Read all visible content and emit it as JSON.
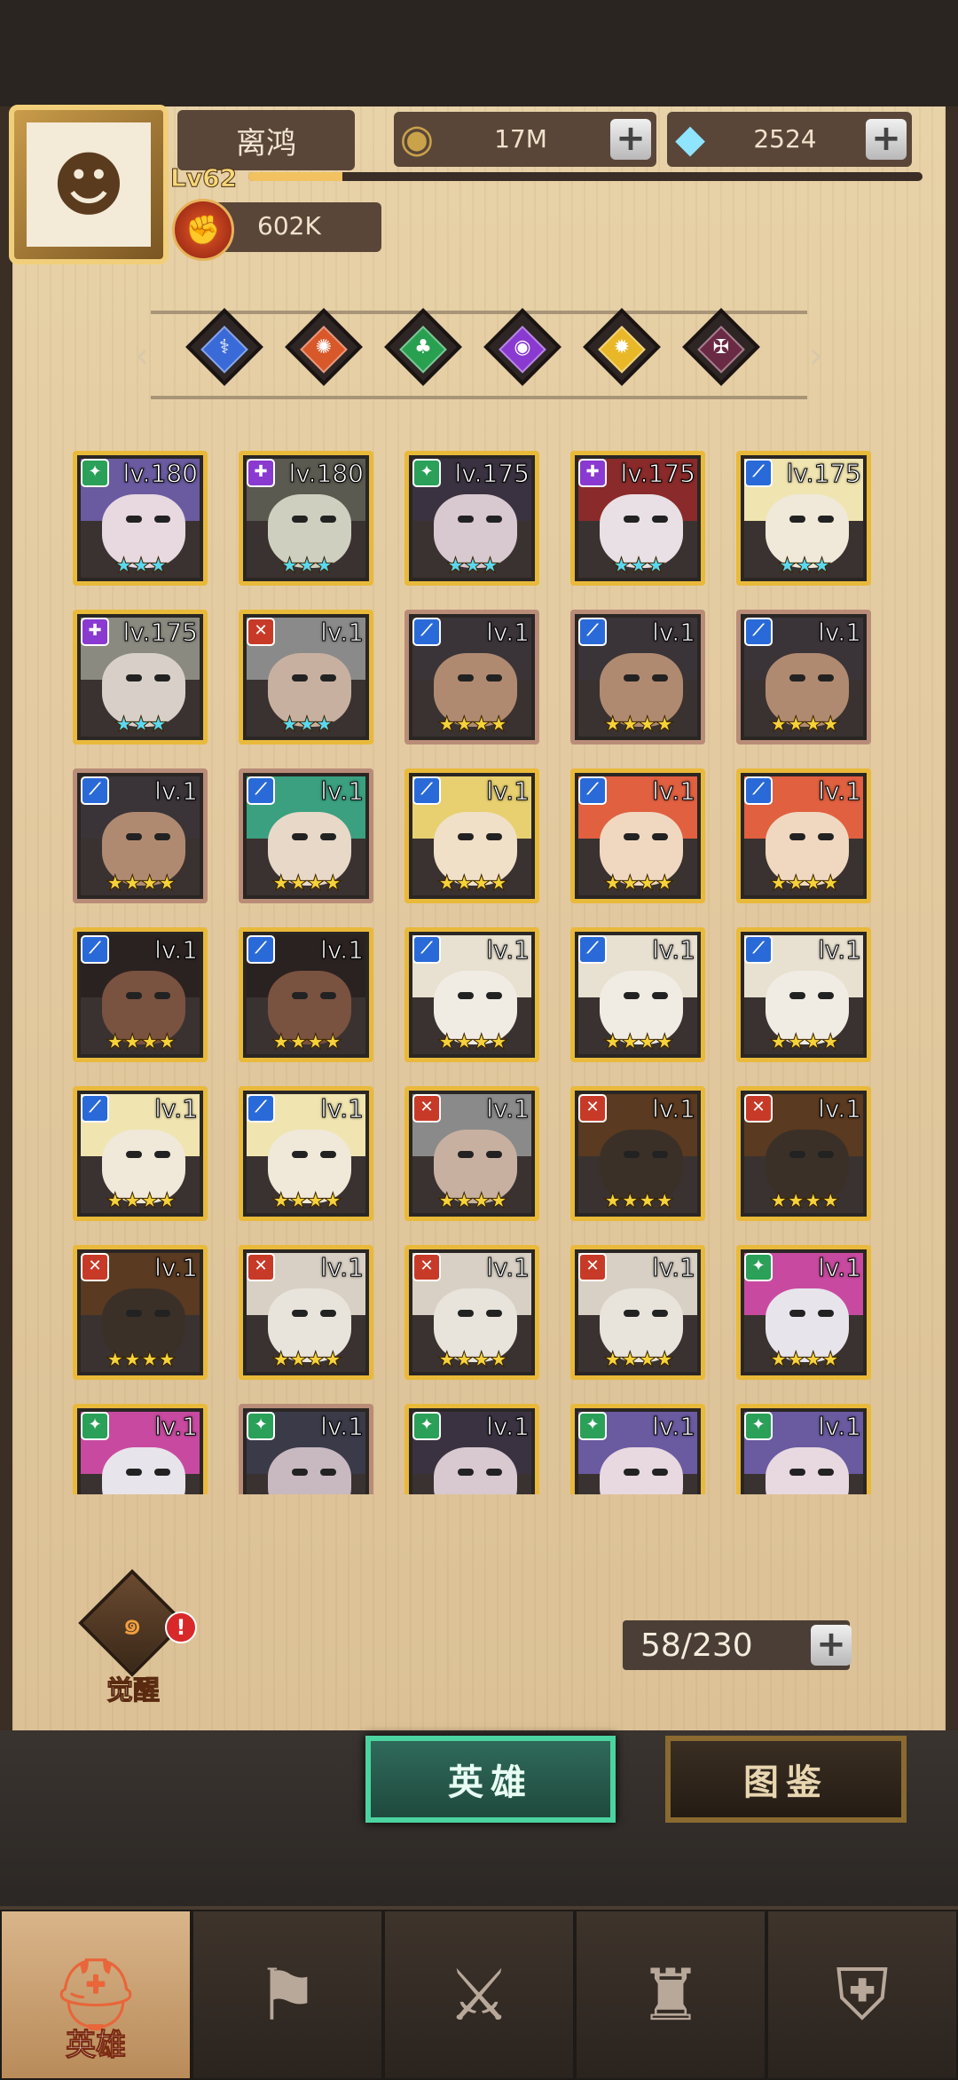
{
  "player": {
    "name": "离鸿",
    "level": "Lv62",
    "power": "602K",
    "xp_fraction": 0.14
  },
  "currencies": [
    {
      "name": "gold",
      "value": "17M",
      "icon": "gold-coin-icon"
    },
    {
      "name": "diamond",
      "value": "2524",
      "icon": "diamond-icon"
    }
  ],
  "filters": [
    {
      "name": "filter-water",
      "color": "#3a6ad8",
      "glyph": "⚕"
    },
    {
      "name": "filter-fire",
      "color": "#d8582a",
      "glyph": "✺"
    },
    {
      "name": "filter-nature",
      "color": "#28a050",
      "glyph": "♣"
    },
    {
      "name": "filter-shadow",
      "color": "#8a3ad0",
      "glyph": "◉"
    },
    {
      "name": "filter-light",
      "color": "#e8b828",
      "glyph": "✹"
    },
    {
      "name": "filter-dark",
      "color": "#6a2a44",
      "glyph": "✠"
    }
  ],
  "heroes": [
    {
      "lv": "lv.180",
      "stars": "★★★",
      "star_color": "#5ad8f0",
      "cls": "green",
      "frame": "gold",
      "hair": "#6a5aa0",
      "skin": "#e8d8e0"
    },
    {
      "lv": "lv.180",
      "stars": "★★★",
      "star_color": "#5ad8f0",
      "cls": "purple",
      "frame": "gold",
      "hair": "#5a5a50",
      "skin": "#cfcfc0"
    },
    {
      "lv": "lv.175",
      "stars": "★★★",
      "star_color": "#5ad8f0",
      "cls": "green",
      "frame": "gold",
      "hair": "#3a3240",
      "skin": "#d8c8d0"
    },
    {
      "lv": "lv.175",
      "stars": "★★★",
      "star_color": "#5ad8f0",
      "cls": "purple",
      "frame": "gold",
      "hair": "#8a2a2a",
      "skin": "#e8e0e4"
    },
    {
      "lv": "lv.175",
      "stars": "★★★",
      "star_color": "#5ad8f0",
      "cls": "blue",
      "frame": "gold",
      "hair": "#f0e4b0",
      "skin": "#f0e8d8"
    },
    {
      "lv": "lv.175",
      "stars": "★★★",
      "star_color": "#5ad8f0",
      "cls": "purple",
      "frame": "gold",
      "hair": "#8a8a80",
      "skin": "#d8d0c8"
    },
    {
      "lv": "lv.1",
      "stars": "★★★",
      "star_color": "#5ad8f0",
      "cls": "red",
      "frame": "gold",
      "hair": "#8a8a8a",
      "skin": "#c8b0a0"
    },
    {
      "lv": "lv.1",
      "stars": "★★★★",
      "star_color": "#f6d23a",
      "cls": "blue",
      "frame": "red",
      "hair": "#3a3438",
      "skin": "#b08a70"
    },
    {
      "lv": "lv.1",
      "stars": "★★★★",
      "star_color": "#f6d23a",
      "cls": "blue",
      "frame": "red",
      "hair": "#3a3438",
      "skin": "#b08a70"
    },
    {
      "lv": "lv.1",
      "stars": "★★★★",
      "star_color": "#f6d23a",
      "cls": "blue",
      "frame": "red",
      "hair": "#3a3438",
      "skin": "#b08a70"
    },
    {
      "lv": "lv.1",
      "stars": "★★★★",
      "star_color": "#f6d23a",
      "cls": "blue",
      "frame": "red",
      "hair": "#3a3438",
      "skin": "#b08a70"
    },
    {
      "lv": "lv.1",
      "stars": "★★★★",
      "star_color": "#f6d23a",
      "cls": "blue",
      "frame": "red",
      "hair": "#3aa080",
      "skin": "#e8d8c8"
    },
    {
      "lv": "lv.1",
      "stars": "★★★★",
      "star_color": "#f6d23a",
      "cls": "blue",
      "frame": "gold",
      "hair": "#e8d070",
      "skin": "#f0e0c8"
    },
    {
      "lv": "lv.1",
      "stars": "★★★★",
      "star_color": "#f6d23a",
      "cls": "blue",
      "frame": "gold",
      "hair": "#e06040",
      "skin": "#f0d8c0"
    },
    {
      "lv": "lv.1",
      "stars": "★★★★",
      "star_color": "#f6d23a",
      "cls": "blue",
      "frame": "gold",
      "hair": "#e06040",
      "skin": "#f0d8c0"
    },
    {
      "lv": "lv.1",
      "stars": "★★★★",
      "star_color": "#f6d23a",
      "cls": "blue",
      "frame": "gold",
      "hair": "#2a2220",
      "skin": "#7a5240"
    },
    {
      "lv": "lv.1",
      "stars": "★★★★",
      "star_color": "#f6d23a",
      "cls": "blue",
      "frame": "gold",
      "hair": "#2a2220",
      "skin": "#7a5240"
    },
    {
      "lv": "lv.1",
      "stars": "★★★★",
      "star_color": "#f6d23a",
      "cls": "blue",
      "frame": "gold",
      "hair": "#e8e0d0",
      "skin": "#f0ece4"
    },
    {
      "lv": "lv.1",
      "stars": "★★★★",
      "star_color": "#f6d23a",
      "cls": "blue",
      "frame": "gold",
      "hair": "#e8e0d0",
      "skin": "#f0ece4"
    },
    {
      "lv": "lv.1",
      "stars": "★★★★",
      "star_color": "#f6d23a",
      "cls": "blue",
      "frame": "gold",
      "hair": "#e8e0d0",
      "skin": "#f0ece4"
    },
    {
      "lv": "lv.1",
      "stars": "★★★★",
      "star_color": "#f6d23a",
      "cls": "blue",
      "frame": "gold",
      "hair": "#f0e4b0",
      "skin": "#f0e8d8"
    },
    {
      "lv": "lv.1",
      "stars": "★★★★",
      "star_color": "#f6d23a",
      "cls": "blue",
      "frame": "gold",
      "hair": "#f0e4b0",
      "skin": "#f0e8d8"
    },
    {
      "lv": "lv.1",
      "stars": "★★★★",
      "star_color": "#f6d23a",
      "cls": "red",
      "frame": "gold",
      "hair": "#8a8a8a",
      "skin": "#c8b0a0"
    },
    {
      "lv": "lv.1",
      "stars": "★★★★",
      "star_color": "#f6d23a",
      "cls": "red",
      "frame": "gold",
      "hair": "#5a3a20",
      "skin": "#3a3028"
    },
    {
      "lv": "lv.1",
      "stars": "★★★★",
      "star_color": "#f6d23a",
      "cls": "red",
      "frame": "gold",
      "hair": "#5a3a20",
      "skin": "#3a3028"
    },
    {
      "lv": "lv.1",
      "stars": "★★★★",
      "star_color": "#f6d23a",
      "cls": "red",
      "frame": "gold",
      "hair": "#5a3a20",
      "skin": "#3a3028"
    },
    {
      "lv": "lv.1",
      "stars": "★★★★",
      "star_color": "#f6d23a",
      "cls": "red",
      "frame": "gold",
      "hair": "#d8d0c4",
      "skin": "#e8e4dc"
    },
    {
      "lv": "lv.1",
      "stars": "★★★★",
      "star_color": "#f6d23a",
      "cls": "red",
      "frame": "gold",
      "hair": "#d8d0c4",
      "skin": "#e8e4dc"
    },
    {
      "lv": "lv.1",
      "stars": "★★★★",
      "star_color": "#f6d23a",
      "cls": "red",
      "frame": "gold",
      "hair": "#d8d0c4",
      "skin": "#e8e4dc"
    },
    {
      "lv": "lv.1",
      "stars": "★★★★",
      "star_color": "#f6d23a",
      "cls": "green",
      "frame": "gold",
      "hair": "#c84aa0",
      "skin": "#e8e4ec"
    },
    {
      "lv": "lv.1",
      "stars": "",
      "star_color": "#f6d23a",
      "cls": "green",
      "frame": "gold",
      "hair": "#c84aa0",
      "skin": "#e8e4ec"
    },
    {
      "lv": "lv.1",
      "stars": "",
      "star_color": "#f6d23a",
      "cls": "green",
      "frame": "red",
      "hair": "#3a3a48",
      "skin": "#c8b8c0"
    },
    {
      "lv": "lv.1",
      "stars": "",
      "star_color": "#f6d23a",
      "cls": "green",
      "frame": "gold",
      "hair": "#3a3240",
      "skin": "#d8c8d0"
    },
    {
      "lv": "lv.1",
      "stars": "",
      "star_color": "#f6d23a",
      "cls": "green",
      "frame": "gold",
      "hair": "#6a5aa0",
      "skin": "#e8d8e0"
    },
    {
      "lv": "lv.1",
      "stars": "",
      "star_color": "#f6d23a",
      "cls": "green",
      "frame": "gold",
      "hair": "#6a5aa0",
      "skin": "#e8d8e0"
    }
  ],
  "awaken": {
    "label": "觉醒",
    "badge": "!"
  },
  "capacity": "58/230",
  "tabs": {
    "heroes": "英雄",
    "codex": "图鉴"
  },
  "nav": [
    {
      "label": "英雄",
      "icon": "hero-helmet-icon",
      "active": true
    },
    {
      "label": "",
      "icon": "guild-flag-icon",
      "active": false
    },
    {
      "label": "",
      "icon": "crossed-swords-icon",
      "active": false
    },
    {
      "label": "",
      "icon": "castle-icon",
      "active": false
    },
    {
      "label": "",
      "icon": "alliance-shield-icon",
      "active": false
    }
  ],
  "colors": {
    "class_green": "#2aa058",
    "class_purple": "#8a3ad0",
    "class_blue": "#2a6ad8",
    "class_red": "#c83a28"
  }
}
